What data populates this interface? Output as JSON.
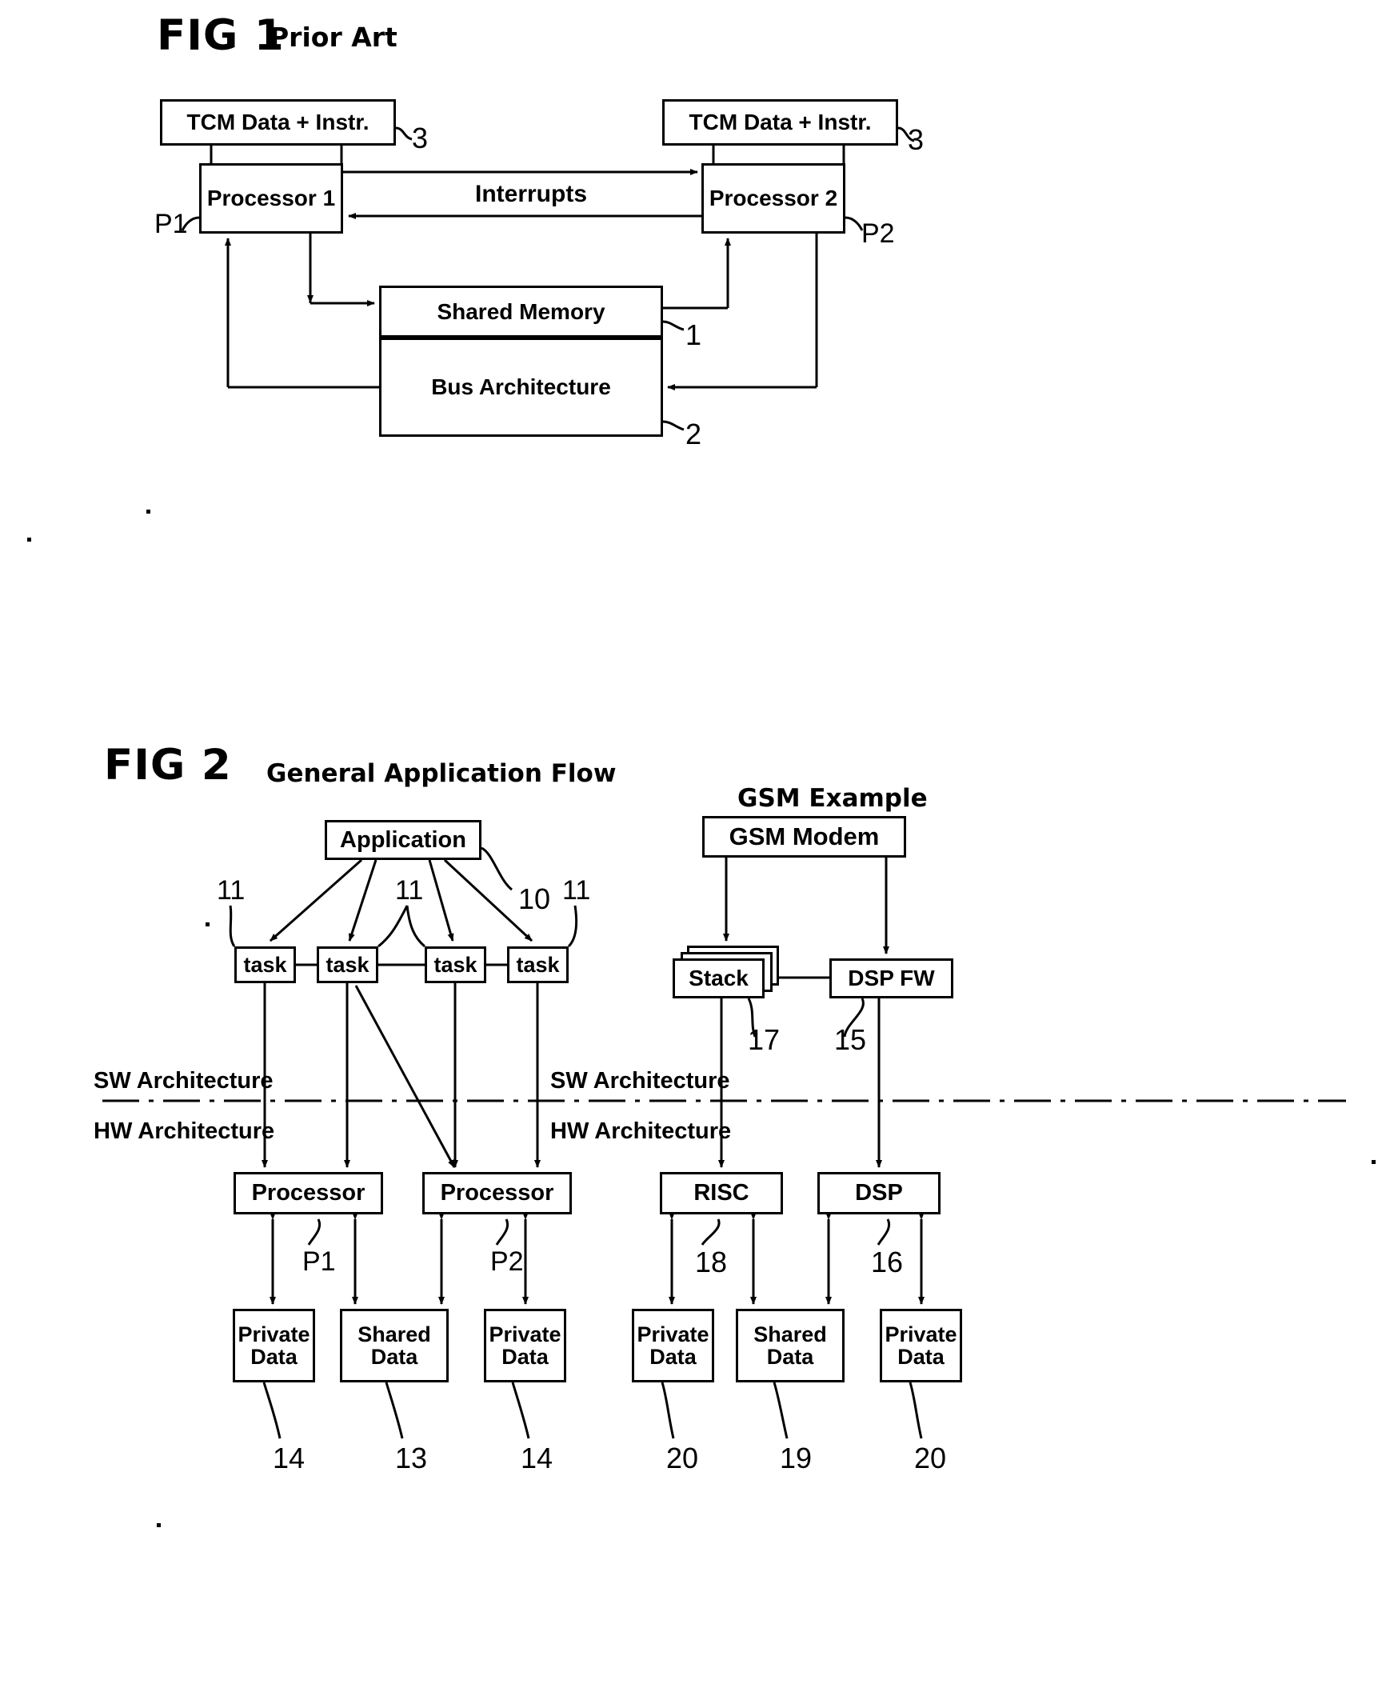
{
  "figure1": {
    "fig_label": "FIG 1",
    "fig_subtitle": "Prior Art",
    "boxes": {
      "tcm_left": "TCM Data + Instr.",
      "tcm_right": "TCM Data + Instr.",
      "proc1": "Processor 1",
      "proc2": "Processor 2",
      "shared_memory": "Shared Memory",
      "bus_architecture": "Bus Architecture"
    },
    "edge_labels": {
      "interrupts": "Interrupts"
    },
    "refs": {
      "tcm_left_ref": "3",
      "tcm_right_ref": "3",
      "proc1_ref": "P1",
      "proc2_ref": "P2",
      "shared_memory_ref": "1",
      "bus_ref": "2"
    }
  },
  "figure2": {
    "fig_label": "FIG 2",
    "left_title": "General Application Flow",
    "right_title": "GSM Example",
    "divider_labels": {
      "sw_left": "SW Architecture",
      "hw_left": "HW Architecture",
      "sw_right": "SW Architecture",
      "hw_right": "HW Architecture"
    },
    "left": {
      "application": "Application",
      "application_ref": "10",
      "tasks": [
        {
          "label": "task"
        },
        {
          "label": "task"
        },
        {
          "label": "task"
        },
        {
          "label": "task"
        }
      ],
      "task_refs": [
        "11",
        "11",
        "11",
        "11"
      ],
      "processors": [
        {
          "label": "Processor",
          "ref": "P1"
        },
        {
          "label": "Processor",
          "ref": "P2"
        }
      ],
      "data_boxes": [
        {
          "line1": "Private",
          "line2": "Data",
          "ref": "14"
        },
        {
          "line1": "Shared",
          "line2": "Data",
          "ref": "13"
        },
        {
          "line1": "Private",
          "line2": "Data",
          "ref": "14"
        }
      ]
    },
    "right": {
      "modem": "GSM Modem",
      "stack": "Stack",
      "stack_ref": "17",
      "dsp_fw": "DSP FW",
      "dsp_fw_ref": "15",
      "risc": "RISC",
      "risc_ref": "18",
      "dsp": "DSP",
      "dsp_ref": "16",
      "data_boxes": [
        {
          "line1": "Private",
          "line2": "Data",
          "ref": "20"
        },
        {
          "line1": "Shared",
          "line2": "Data",
          "ref": "19"
        },
        {
          "line1": "Private",
          "line2": "Data",
          "ref": "20"
        }
      ]
    }
  },
  "colors": {
    "ink": "#000000",
    "paper": "#ffffff"
  }
}
